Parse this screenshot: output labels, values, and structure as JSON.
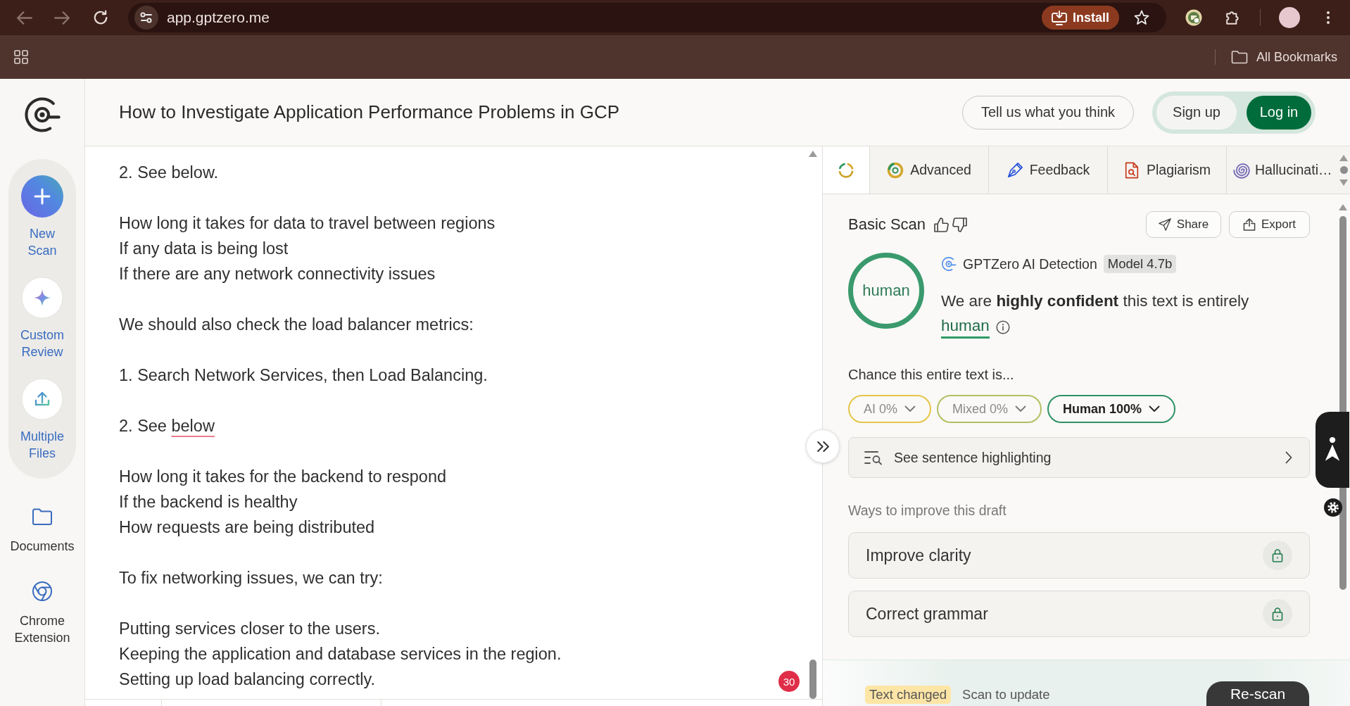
{
  "browser": {
    "back": {
      "disabled": true
    },
    "forward": {
      "disabled": true
    },
    "url": "app.gptzero.me",
    "install_button": "Install",
    "bookmarks_button": "All Bookmarks"
  },
  "sidebar": {
    "actions": [
      {
        "kind": "new_scan",
        "label": "New Scan"
      },
      {
        "kind": "custom_review",
        "label": "Custom Review"
      },
      {
        "kind": "multiple_files",
        "label": "Multiple Files"
      }
    ],
    "links": [
      {
        "kind": "documents",
        "label": "Documents"
      },
      {
        "kind": "extension",
        "label": "Chrome Extension"
      }
    ]
  },
  "header": {
    "title": "How to Investigate Application Performance Problems in GCP",
    "feedback_button": "Tell us what you think",
    "sign_up_button": "Sign up",
    "log_in_button": "Log in"
  },
  "editor": {
    "paragraphs": [
      [
        {
          "text": "2. See below."
        }
      ],
      [
        {
          "text": "How long it takes for data to travel between regions"
        },
        {
          "text": "If any data is being lost"
        },
        {
          "text": "If there are any network connectivity issues"
        }
      ],
      [
        {
          "text": "We should also check the load balancer metrics:"
        }
      ],
      [
        {
          "text": "1. Search Network Services, then Load Balancing."
        }
      ],
      [
        {
          "text": "2. See ",
          "flagged_text": "below"
        }
      ],
      [
        {
          "text": "How long it takes for the backend to respond"
        },
        {
          "text": "If the backend is healthy"
        },
        {
          "text": "How requests are being distributed"
        }
      ],
      [
        {
          "text": "To fix networking issues, we can try:"
        }
      ],
      [
        {
          "text": "Putting services closer to the users."
        },
        {
          "text": "Keeping the application and database services in the region."
        },
        {
          "text": "Setting up load balancing correctly."
        }
      ]
    ],
    "issue_count": "30"
  },
  "panel": {
    "tabs": [
      {
        "kind": "basic",
        "selected": true
      },
      {
        "kind": "advanced",
        "label": "Advanced",
        "selected": false
      },
      {
        "kind": "feedback",
        "label": "Feedback",
        "selected": false
      },
      {
        "kind": "plagiarism",
        "label": "Plagiarism",
        "selected": false
      },
      {
        "kind": "hallucination",
        "label": "Hallucinati…",
        "selected": false
      }
    ],
    "scan": {
      "title": "Basic Scan",
      "share_button": "Share",
      "export_button": "Export",
      "result_label": "human",
      "detector": "GPTZero AI Detection",
      "model_badge": "Model 4.7b",
      "verdict": "We are **highly confident** this text is entirely",
      "verdict_label": "human",
      "chance_label": "Chance this entire text is...",
      "chances": [
        {
          "label": "AI 0%",
          "color": "#e6c54a",
          "selected": false
        },
        {
          "label": "Mixed 0%",
          "color": "#b4bf62",
          "selected": false
        },
        {
          "label": "Human 100%",
          "color": "#2f9266",
          "selected": true
        }
      ],
      "highlighting_button": "See sentence highlighting",
      "improve_heading": "Ways to improve this draft",
      "improvements": [
        {
          "label": "Improve clarity",
          "locked": true
        },
        {
          "label": "Correct grammar",
          "locked": true
        }
      ]
    },
    "status_bar": {
      "badge": "Text changed",
      "message": "Scan to update",
      "rescan_button": "Re-scan"
    }
  }
}
